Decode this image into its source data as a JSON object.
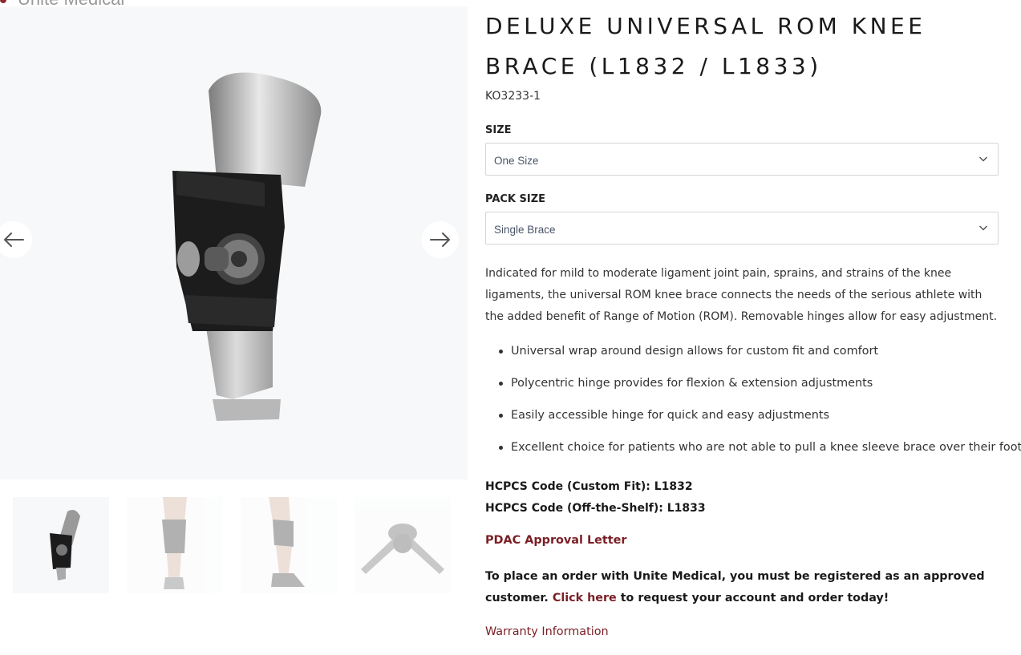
{
  "brand": {
    "logo_text": "Unite Medical"
  },
  "product": {
    "title": "DELUXE UNIVERSAL ROM KNEE BRACE (L1832 / L1833)",
    "sku": "KO3233-1"
  },
  "options": {
    "size_label": "SIZE",
    "size_value": "One Size",
    "pack_label": "PACK SIZE",
    "pack_value": "Single Brace"
  },
  "description": "Indicated for mild to moderate ligament joint pain, sprains, and strains of the knee ligaments, the universal ROM knee brace connects the needs of the serious athlete with the added benefit of Range of Motion (ROM). Removable hinges allow for easy adjustment.",
  "features": [
    "Universal wrap around design allows for custom fit and comfort",
    "Polycentric hinge provides for flexion & extension adjustments",
    "Easily accessible hinge for quick and easy adjustments",
    "Excellent choice for patients who are not able to pull a knee sleeve brace over their foot"
  ],
  "hcpcs": {
    "custom": "HCPCS Code (Custom Fit): L1832",
    "ots": "HCPCS Code (Off-the-Shelf): L1833"
  },
  "links": {
    "pdac": "PDAC Approval Letter",
    "order_prefix": "To place an order with Unite Medical, you must be registered as an approved customer.",
    "order_link": "Click here",
    "order_suffix": "to request your account and order today!",
    "warranty": "Warranty Information"
  },
  "gallery": {
    "icons": {
      "prev": "arrow-left-icon",
      "next": "arrow-right-icon"
    },
    "thumbnails": [
      "knee-brace-mannequin",
      "knee-brace-worn-front",
      "knee-brace-worn-back",
      "hinge-component"
    ],
    "active_thumbnail": 0
  },
  "colors": {
    "accent": "#7a1f25",
    "gallery_bg": "#f7f8fa"
  }
}
